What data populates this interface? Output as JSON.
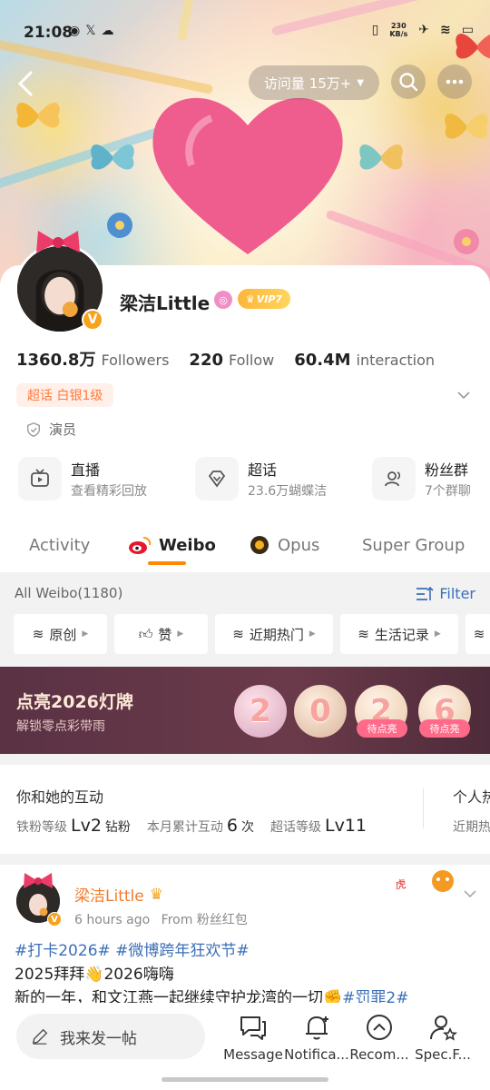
{
  "status_bar": {
    "time": "21:08",
    "speed": "230\nKB/s"
  },
  "header": {
    "visits_label": "访问量 15万+"
  },
  "profile": {
    "name": "梁洁Little",
    "vip_label": "VIP7",
    "followers_count": "1360.8万",
    "followers_label": "Followers",
    "follow_count": "220",
    "follow_label": "Follow",
    "interaction_count": "60.4M",
    "interaction_label": "interaction",
    "super_topic_chip": "超话 白银1级",
    "role": "演员"
  },
  "quick_links": [
    {
      "title": "直播",
      "subtitle": "查看精彩回放",
      "icon": "tv-icon"
    },
    {
      "title": "超话",
      "subtitle": "23.6万蝴蝶洁",
      "icon": "diamond-icon"
    },
    {
      "title": "粉丝群",
      "subtitle": "7个群聊",
      "icon": "group-icon"
    }
  ],
  "tabs": [
    {
      "label": "Activity"
    },
    {
      "label": "Weibo",
      "active": true
    },
    {
      "label": "Opus"
    },
    {
      "label": "Super Group"
    }
  ],
  "feed": {
    "all_weibo": "All Weibo(1180)",
    "filter_label": "Filter",
    "chips": [
      "原创",
      "赞",
      "近期热门",
      "生活记录"
    ]
  },
  "promo": {
    "title": "点亮2026灯牌",
    "subtitle": "解锁零点彩带雨",
    "digits": [
      "2",
      "0",
      "2",
      "6"
    ],
    "pending_label": "待点亮"
  },
  "interaction": {
    "title": "你和她的互动",
    "iron_fan_label": "铁粉等级",
    "iron_fan_level": "Lv2",
    "iron_fan_suffix": "钻粉",
    "monthly_label": "本月累计互动",
    "monthly_value": "6",
    "monthly_unit": "次",
    "super_label": "超话等级",
    "super_value": "Lv11",
    "side_title": "个人热",
    "side_sub": "近期热"
  },
  "post": {
    "author": "梁洁Little",
    "time": "6 hours ago",
    "source": "From 粉丝红包",
    "tag1": "#打卡2026#",
    "tag2": "#微博跨年狂欢节#",
    "line2_a": "2025拜拜",
    "line2_b": "2026嗨嗨",
    "line3": "新的一年，和文江燕一起继续守护龙湾的一切",
    "tag3": "#罚罪2#"
  },
  "bottom_bar": {
    "compose_placeholder": "我来发一帖",
    "nav": [
      "Message",
      "Notifica...",
      "Recom...",
      "Spec.F..."
    ]
  },
  "colors": {
    "accent": "#ff8a00",
    "link": "#3b6fb6",
    "name_orange": "#f27b2a",
    "promo_bg": "#5a3244"
  }
}
